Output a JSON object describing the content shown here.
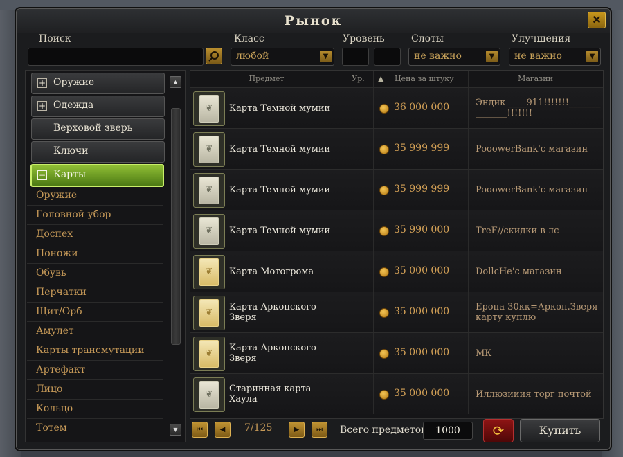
{
  "window": {
    "title": "Рынок",
    "close_label": "✕"
  },
  "filters": {
    "search_label": "Поиск",
    "search_value": "",
    "class_label": "Класс",
    "class_value": "любой",
    "level_label": "Уровень",
    "level_min": "",
    "level_max": "",
    "slots_label": "Слоты",
    "slots_value": "не важно",
    "upgrades_label": "Улучшения",
    "upgrades_value": "не важно"
  },
  "categories": [
    {
      "label": "Оружие",
      "state": "+"
    },
    {
      "label": "Одежда",
      "state": "+"
    },
    {
      "label": "Верховой зверь",
      "state": ""
    },
    {
      "label": "Ключи",
      "state": ""
    },
    {
      "label": "Карты",
      "state": "−"
    }
  ],
  "subcategories": [
    "Оружие",
    "Головной убор",
    "Доспех",
    "Поножи",
    "Обувь",
    "Перчатки",
    "Щит/Орб",
    "Амулет",
    "Карты трансмутации",
    "Артефакт",
    "Лицо",
    "Кольцо",
    "Тотем"
  ],
  "grid": {
    "col_item": "Предмет",
    "col_level": "Ур.",
    "sort_icon": "▲",
    "col_price": "Цена за штуку",
    "col_shop": "Магазин"
  },
  "rows": [
    {
      "name": "Карта Темной мумии",
      "level": "",
      "price": "36 000 000",
      "shop": "Эндик ____911!!!!!!!______________!!!!!!!",
      "card": "silver"
    },
    {
      "name": "Карта Темной мумии",
      "level": "",
      "price": "35 999 999",
      "shop": "PooowerBank'с магазин",
      "card": "silver"
    },
    {
      "name": "Карта Темной мумии",
      "level": "",
      "price": "35 999 999",
      "shop": "PooowerBank'с магазин",
      "card": "silver"
    },
    {
      "name": "Карта Темной мумии",
      "level": "",
      "price": "35 990 000",
      "shop": "TreF//скидки в лс",
      "card": "silver"
    },
    {
      "name": "Карта Мотогрома",
      "level": "",
      "price": "35 000 000",
      "shop": "DollcHe'с магазин",
      "card": "gold"
    },
    {
      "name": "Карта Арконского Зверя",
      "level": "",
      "price": "35 000 000",
      "shop": "Еропа 30кк=Аркон.Зверя карту куплю",
      "card": "gold"
    },
    {
      "name": "Карта Арконского Зверя",
      "level": "",
      "price": "35 000 000",
      "shop": "МК",
      "card": "gold"
    },
    {
      "name": "Старинная карта Хаула",
      "level": "",
      "price": "35 000 000",
      "shop": "Иллюзииия торг почтой",
      "card": "silver"
    }
  ],
  "pager": {
    "text": "7/125"
  },
  "footer": {
    "total_label": "Всего предметов",
    "total_value": "1000",
    "refresh_icon": "⟳",
    "buy_label": "Купить"
  }
}
